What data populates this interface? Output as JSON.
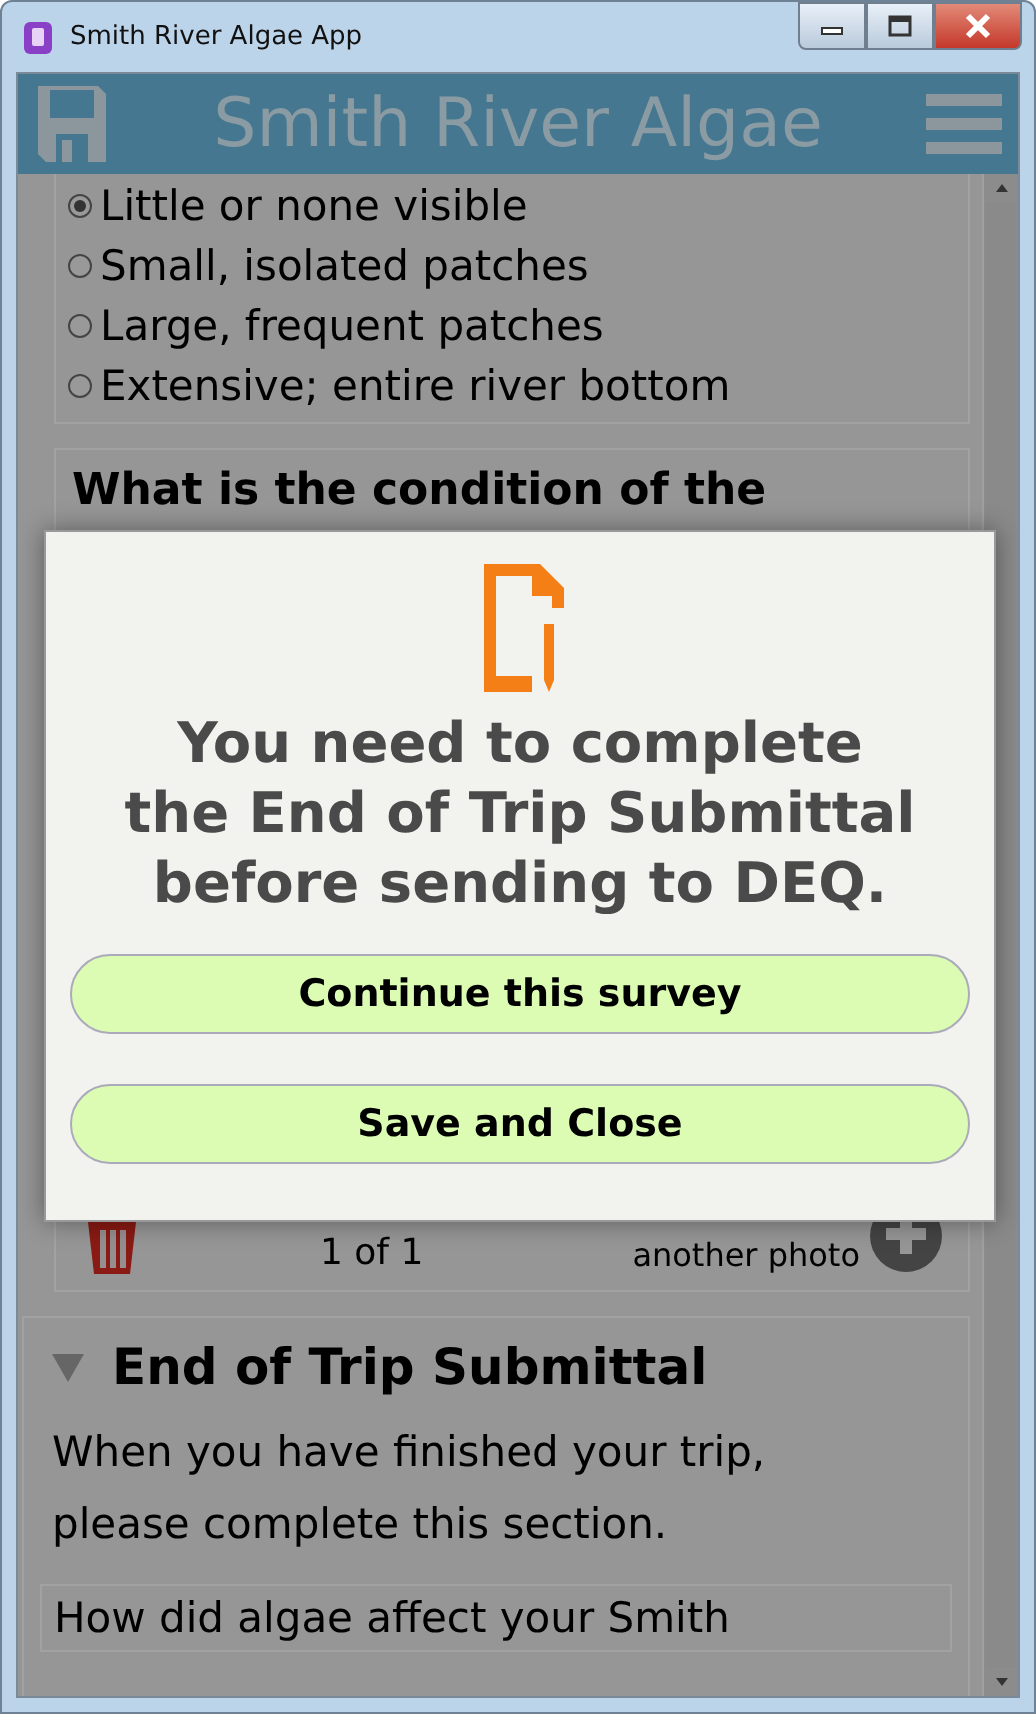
{
  "window": {
    "title": "Smith River Algae App"
  },
  "header": {
    "title": "Smith River Algae"
  },
  "radio_options": [
    {
      "label": "Little or none visible",
      "selected": true
    },
    {
      "label": "Small, isolated patches",
      "selected": false
    },
    {
      "label": "Large, frequent patches",
      "selected": false
    },
    {
      "label": "Extensive; entire river bottom",
      "selected": false
    }
  ],
  "next_question": "What is the condition of the",
  "photo_row": {
    "counter": "1 of 1",
    "add_label": "another photo"
  },
  "section": {
    "title": "End of Trip Submittal",
    "expanded": true,
    "description": "When you have finished your trip, please complete this section.",
    "question": "How did algae affect your Smith"
  },
  "dialog": {
    "message": "You need to complete the End of Trip Submittal before sending to DEQ.",
    "buttons": [
      "Continue this survey",
      "Save and Close"
    ]
  }
}
